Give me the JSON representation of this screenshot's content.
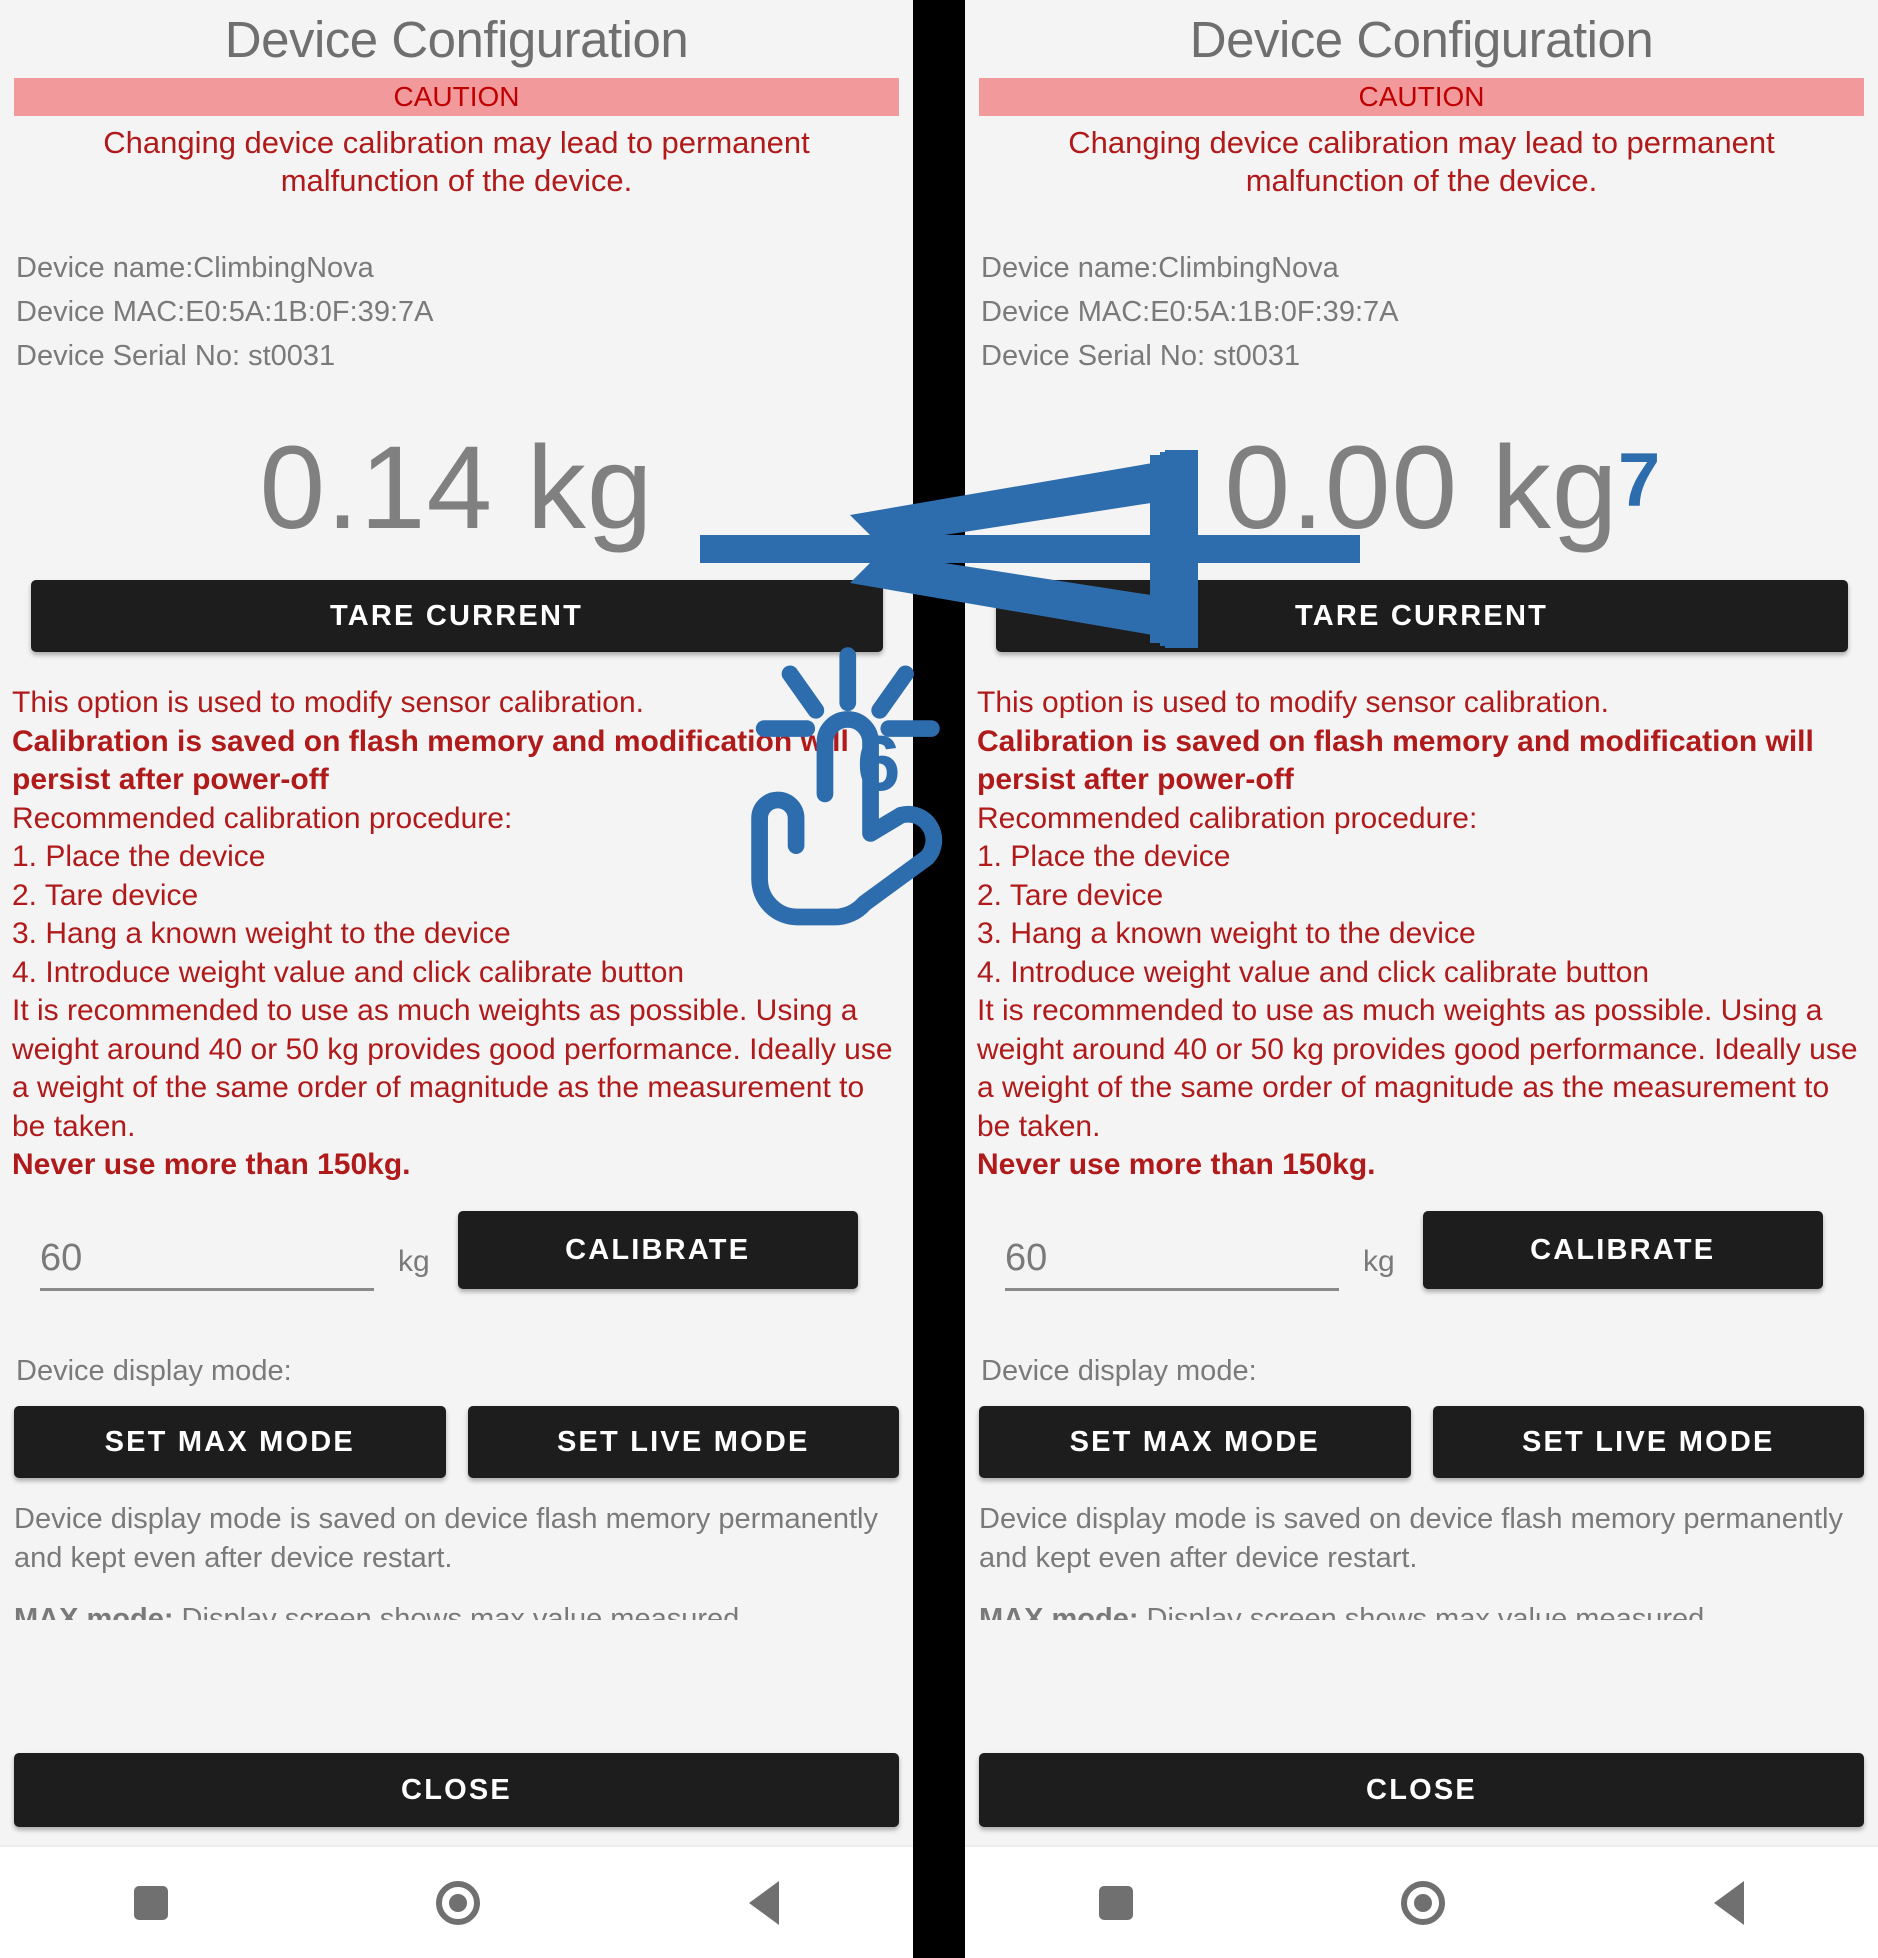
{
  "app": {
    "title": "Device Configuration",
    "caution_label": "CAUTION",
    "caution_message": "Changing device calibration may lead to permanent malfunction of the device."
  },
  "device": {
    "name_line": "Device name:ClimbingNova",
    "mac_line": "Device MAC:E0:5A:1B:0F:39:7A",
    "serial_line": "Device Serial No: st0031"
  },
  "panels": {
    "left": {
      "weight": "0.14 kg"
    },
    "right": {
      "weight": "0.00 kg"
    }
  },
  "buttons": {
    "tare": "TARE CURRENT",
    "calibrate": "CALIBRATE",
    "set_max_mode": "SET MAX MODE",
    "set_live_mode": "SET LIVE MODE",
    "close": "CLOSE"
  },
  "instructions": {
    "line1": "This option is used to modify sensor calibration.",
    "bold1": "Calibration is saved on flash memory and modification will persist after power-off",
    "line2": " Recommended calibration procedure:",
    "step1": " 1. Place the device",
    "step2": " 2. Tare device",
    "step3": " 3. Hang a known weight to the device",
    "step4": " 4. Introduce weight value and click calibrate button",
    "line3": " It is recommended to use as much weights as possible. Using a weight around 40 or 50 kg provides good performance. Ideally use a weight of the same order of magnitude as the measurement to be taken.",
    "bold2": " Never use more than 150kg."
  },
  "calibration": {
    "weight_value": "60",
    "weight_placeholder": "60",
    "unit": "kg"
  },
  "display_mode": {
    "label": "Device display mode:",
    "note": "Device display mode is saved on device flash memory permanently and kept even after device restart.",
    "note_clipped_bold": "MAX mode:",
    "note_clipped_rest": " Display screen shows max value measured"
  },
  "annotations": {
    "step_marker_hand": "6",
    "step_marker_result": "7",
    "arrow_color": "#2e6dad",
    "accent_color": "#2e6dad"
  },
  "navbar": {
    "recents": "recents-square-icon",
    "home": "home-circle-icon",
    "back": "back-triangle-icon"
  },
  "colors": {
    "background": "#f4f4f4",
    "caution_banner": "#f1999b",
    "caution_text": "#b01a1a",
    "button_dark": "#1d1d1d",
    "muted_text": "#7a7a7a",
    "weight_text": "#808080",
    "separator": "#000000"
  }
}
